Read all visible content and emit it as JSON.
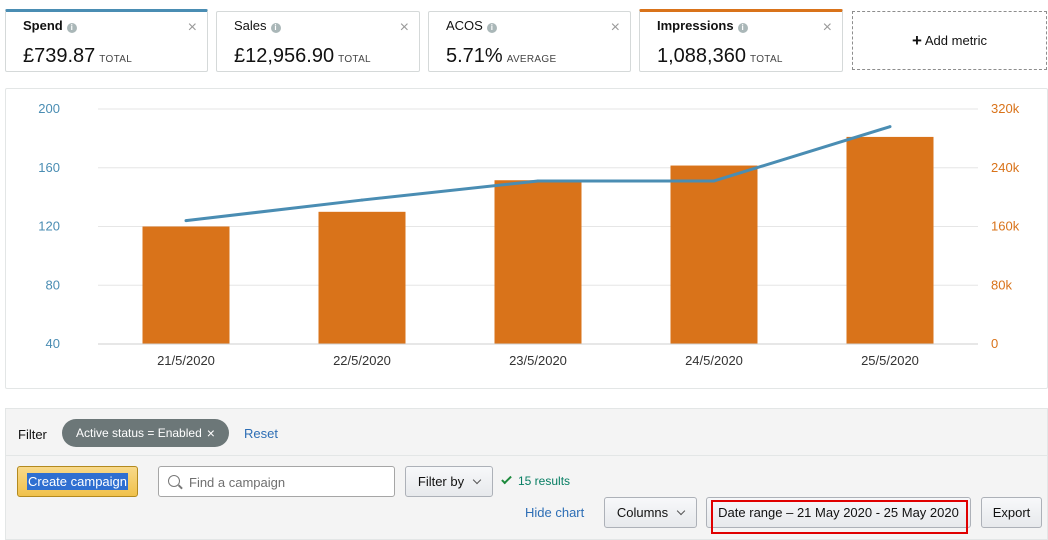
{
  "metrics": [
    {
      "name": "Spend",
      "value": "£739.87",
      "unit": "TOTAL"
    },
    {
      "name": "Sales",
      "value": "£12,956.90",
      "unit": "TOTAL"
    },
    {
      "name": "ACOS",
      "value": "5.71%",
      "unit": "AVERAGE"
    },
    {
      "name": "Impressions",
      "value": "1,088,360",
      "unit": "TOTAL"
    }
  ],
  "add_metric_label": "Add metric",
  "colors": {
    "spend_line": "#4a8db3",
    "impressions_bar": "#d9731a"
  },
  "chart_data": {
    "type": "bar",
    "categories": [
      "21/5/2020",
      "22/5/2020",
      "23/5/2020",
      "24/5/2020",
      "25/5/2020"
    ],
    "series": [
      {
        "type": "bar",
        "axis": "right",
        "values": [
          160000,
          180000,
          223000,
          243000,
          282000
        ]
      },
      {
        "type": "line",
        "axis": "left",
        "values": [
          124,
          138,
          151,
          151,
          188
        ]
      }
    ],
    "left_axis": {
      "ylim": [
        40,
        200
      ],
      "ticks": [
        "40",
        "80",
        "120",
        "160",
        "200"
      ]
    },
    "right_axis": {
      "ylim": [
        0,
        320000
      ],
      "ticks": [
        "0",
        "80k",
        "160k",
        "240k",
        "320k"
      ]
    },
    "grid": true
  },
  "filter": {
    "label": "Filter",
    "pill": "Active status = Enabled",
    "reset": "Reset"
  },
  "toolbar": {
    "create_campaign": "Create campaign",
    "search_placeholder": "Find a campaign",
    "filter_by": "Filter by",
    "results": "15 results",
    "hide_chart": "Hide chart",
    "columns": "Columns",
    "date_range": "Date range – 21 May 2020 - 25 May 2020",
    "export": "Export"
  }
}
